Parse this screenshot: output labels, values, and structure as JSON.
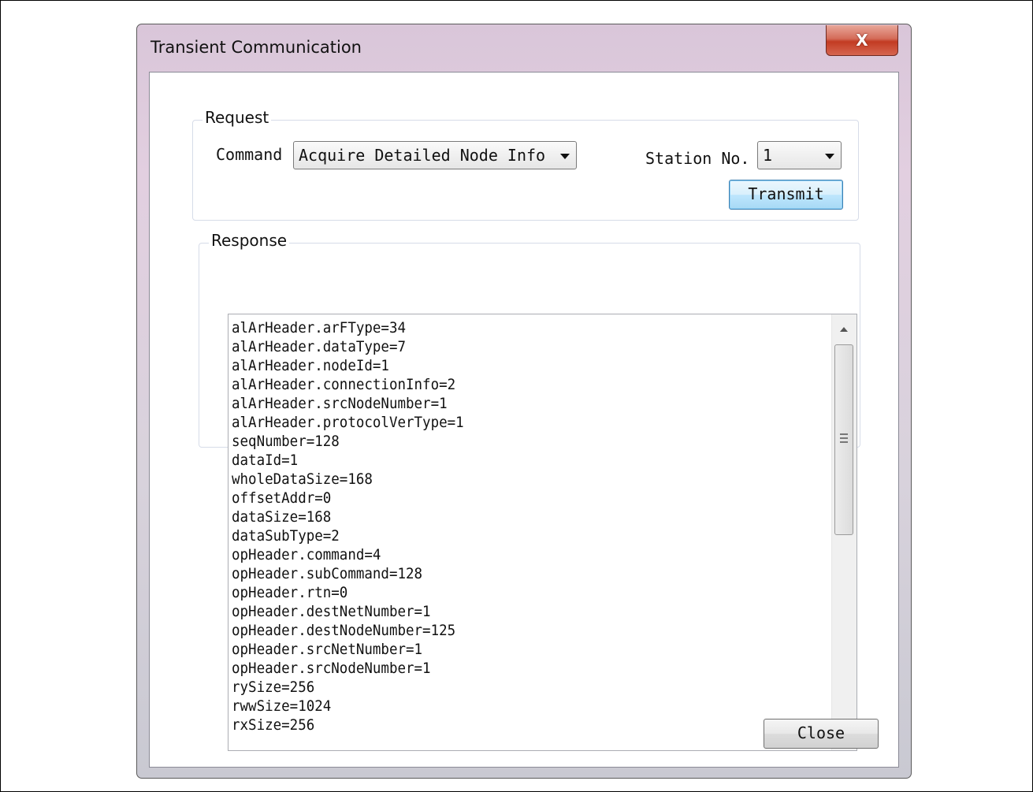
{
  "window": {
    "title": "Transient Communication",
    "close_glyph": "X"
  },
  "request": {
    "legend": "Request",
    "command_label": "Command",
    "command_value": "Acquire Detailed Node Info",
    "station_label": "Station No.",
    "station_value": "1",
    "transmit_label": "Transmit"
  },
  "response": {
    "legend": "Response",
    "lines": [
      "alArHeader.arFType=34",
      "alArHeader.dataType=7",
      "alArHeader.nodeId=1",
      "alArHeader.connectionInfo=2",
      "alArHeader.srcNodeNumber=1",
      "alArHeader.protocolVerType=1",
      "seqNumber=128",
      "dataId=1",
      "wholeDataSize=168",
      "offsetAddr=0",
      "dataSize=168",
      "dataSubType=2",
      "opHeader.command=4",
      "opHeader.subCommand=128",
      "opHeader.rtn=0",
      "opHeader.destNetNumber=1",
      "opHeader.destNodeNumber=125",
      "opHeader.srcNetNumber=1",
      "opHeader.srcNodeNumber=1",
      "rySize=256",
      "rwwSize=1024",
      "rxSize=256"
    ]
  },
  "footer": {
    "close_label": "Close"
  }
}
